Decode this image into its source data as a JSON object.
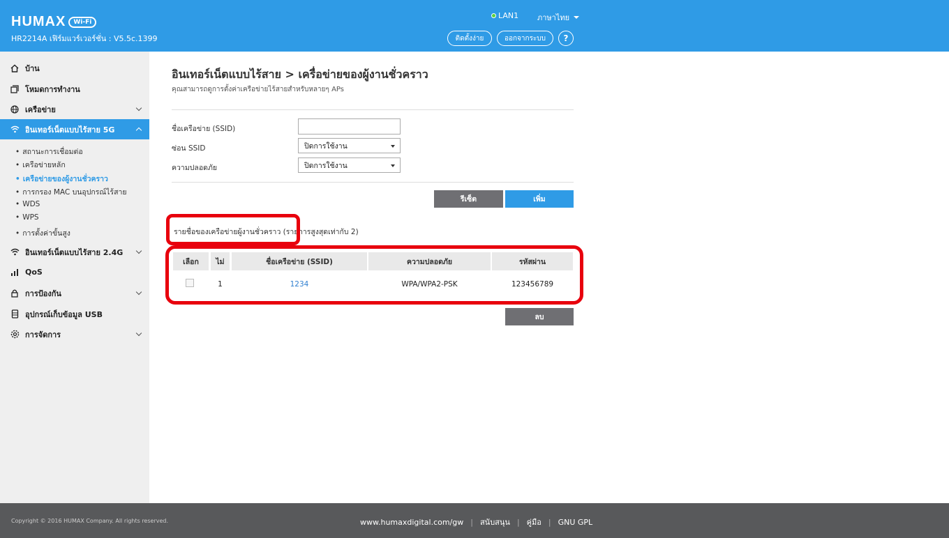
{
  "header": {
    "brand": "HUMAX",
    "brand_badge": "Wi-Fi",
    "version": "HR2214A เฟิร์มแวร์เวอร์ชั่น : V5.5c.1399",
    "lan_status": "LAN1",
    "language": "ภาษาไทย",
    "setup_button": "ติดตั้งง่าย",
    "logout_button": "ออกจากระบบ",
    "help_button": "?"
  },
  "sidebar": {
    "items": [
      {
        "label": "บ้าน",
        "icon": "home-icon"
      },
      {
        "label": "โหมดการทำงาน",
        "icon": "mode-icon"
      },
      {
        "label": "เครือข่าย",
        "icon": "globe-icon"
      },
      {
        "label": "อินเทอร์เน็ตแบบไร้สาย 5G",
        "icon": "wifi-icon"
      },
      {
        "label": "อินเทอร์เน็ตแบบไร้สาย 2.4G",
        "icon": "wifi-icon"
      },
      {
        "label": "QoS",
        "icon": "bar-chart-icon"
      },
      {
        "label": "การป้องกัน",
        "icon": "lock-icon"
      },
      {
        "label": "อุปกรณ์เก็บข้อมูล USB",
        "icon": "usb-storage-icon"
      },
      {
        "label": "การจัดการ",
        "icon": "gear-icon"
      }
    ],
    "sub_items": [
      "สถานะการเชื่อมต่อ",
      "เครือข่ายหลัก",
      "เครือข่ายของผู้งานชั่วคราว",
      "การกรอง MAC บนอุปกรณ์ไร้สาย",
      "WDS",
      "WPS",
      "การตั้งค่าขั้นสูง"
    ]
  },
  "main": {
    "title": "อินเทอร์เน็ตแบบไร้สาย > เครื่อข่ายของผู้งานชั่วคราว",
    "description": "คุณสามารถดูการตั้งค่าเครือข่ายไร้สายสำหรับหลายๆ APs",
    "form": {
      "ssid_label": "ชื่อเครือข่าย (SSID)",
      "ssid_value": "",
      "hide_ssid_label": "ซ่อน SSID",
      "hide_ssid_value": "ปิดการใช้งาน",
      "security_label": "ความปลอดภัย",
      "security_value": "ปิดการใช้งาน"
    },
    "reset_button": "รีเซ็ต",
    "add_button": "เพิ่ม",
    "list_title": "รายชื่อของเครือข่ายผู้งานชั่วคราว  (รายการสูงสุดเท่ากับ 2)",
    "table": {
      "headers": [
        "เลือก",
        "ไม่",
        "ชื่อเครือข่าย (SSID)",
        "ความปลอดภัย",
        "รหัสผ่าน"
      ],
      "rows": [
        {
          "no": "1",
          "ssid": "1234",
          "security": "WPA/WPA2-PSK",
          "password": "123456789"
        }
      ]
    },
    "delete_button": "ลบ"
  },
  "footer": {
    "copyright": "Copyright © 2016 HUMAX Company. All rights reserved.",
    "website": "www.humaxdigital.com/gw",
    "support": "สนับสนุน",
    "manual": "คู่มือ",
    "gpl": "GNU GPL"
  },
  "colors": {
    "accent": "#2f9be6",
    "highlight": "#e8000d",
    "footer": "#58595b",
    "sidebar": "#efefef"
  }
}
